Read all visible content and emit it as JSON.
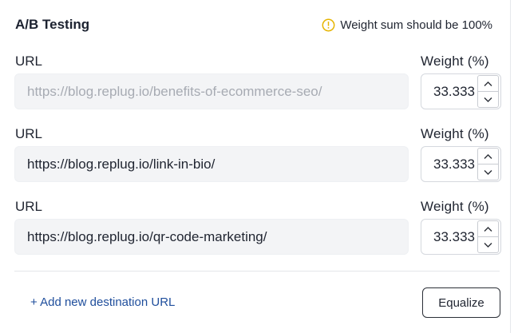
{
  "panel": {
    "title": "A/B Testing",
    "warning_text": "Weight sum should be 100%",
    "warning_icon": "info-circle-icon",
    "warning_color": "#e6b400"
  },
  "rows": [
    {
      "url_label": "URL",
      "weight_label": "Weight (%)",
      "url_value": "",
      "url_placeholder": "https://blog.replug.io/benefits-of-ecommerce-seo/",
      "weight_value": "33.333"
    },
    {
      "url_label": "URL",
      "weight_label": "Weight (%)",
      "url_value": "https://blog.replug.io/link-in-bio/",
      "url_placeholder": "",
      "weight_value": "33.333"
    },
    {
      "url_label": "URL",
      "weight_label": "Weight (%)",
      "url_value": "https://blog.replug.io/qr-code-marketing/",
      "url_placeholder": "",
      "weight_value": "33.333"
    }
  ],
  "footer": {
    "add_link_label": "+ Add new destination URL",
    "equalize_label": "Equalize",
    "link_color": "#1f4e9c"
  }
}
